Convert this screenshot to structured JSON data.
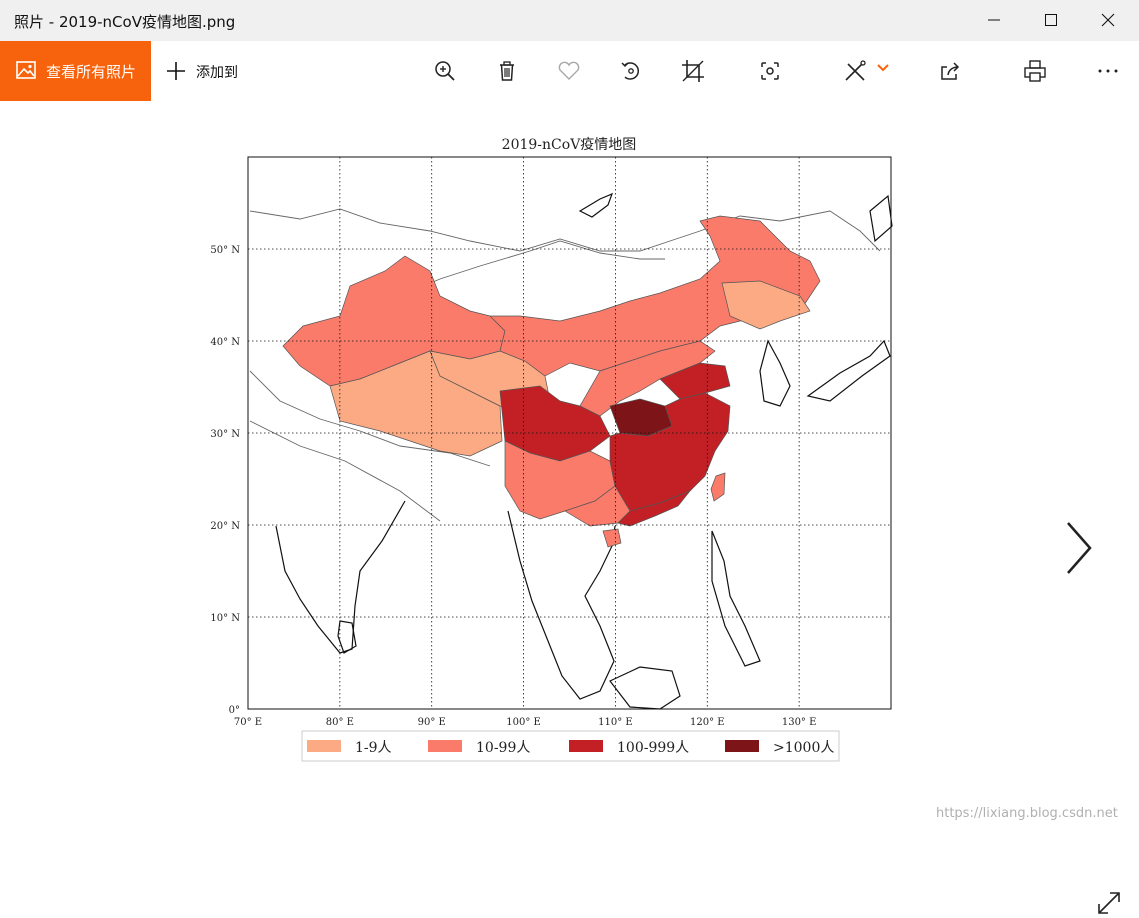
{
  "window": {
    "title": "照片 - 2019-nCoV疫情地图.png"
  },
  "toolbar": {
    "view_all_label": "查看所有照片",
    "add_to_label": "添加到",
    "icons": [
      "zoom-in-icon",
      "delete-icon",
      "favorite-icon",
      "rotate-icon",
      "crop-icon",
      "enhance-icon",
      "edit-draw-icon",
      "share-icon",
      "print-icon",
      "more-icon"
    ],
    "accent": "#f7630c"
  },
  "chart_data": {
    "type": "map",
    "title": "2019-nCoV疫情地图",
    "x_ticks": [
      "70° E",
      "80° E",
      "90° E",
      "100° E",
      "110° E",
      "120° E",
      "130° E"
    ],
    "y_ticks": [
      "0°",
      "10° N",
      "20° N",
      "30° N",
      "40° N",
      "50° N"
    ],
    "xlim": [
      70,
      140
    ],
    "ylim": [
      0,
      60
    ],
    "grid": true,
    "legend_position": "bottom",
    "legend": [
      {
        "label": "1-9人",
        "color": "#fcaa83"
      },
      {
        "label": "10-99人",
        "color": "#fb7b6a"
      },
      {
        "label": "100-999人",
        "color": "#c22025"
      },
      {
        "label": ">1000人",
        "color": "#7d1418"
      }
    ]
  },
  "watermark": "https://lixiang.blog.csdn.net"
}
